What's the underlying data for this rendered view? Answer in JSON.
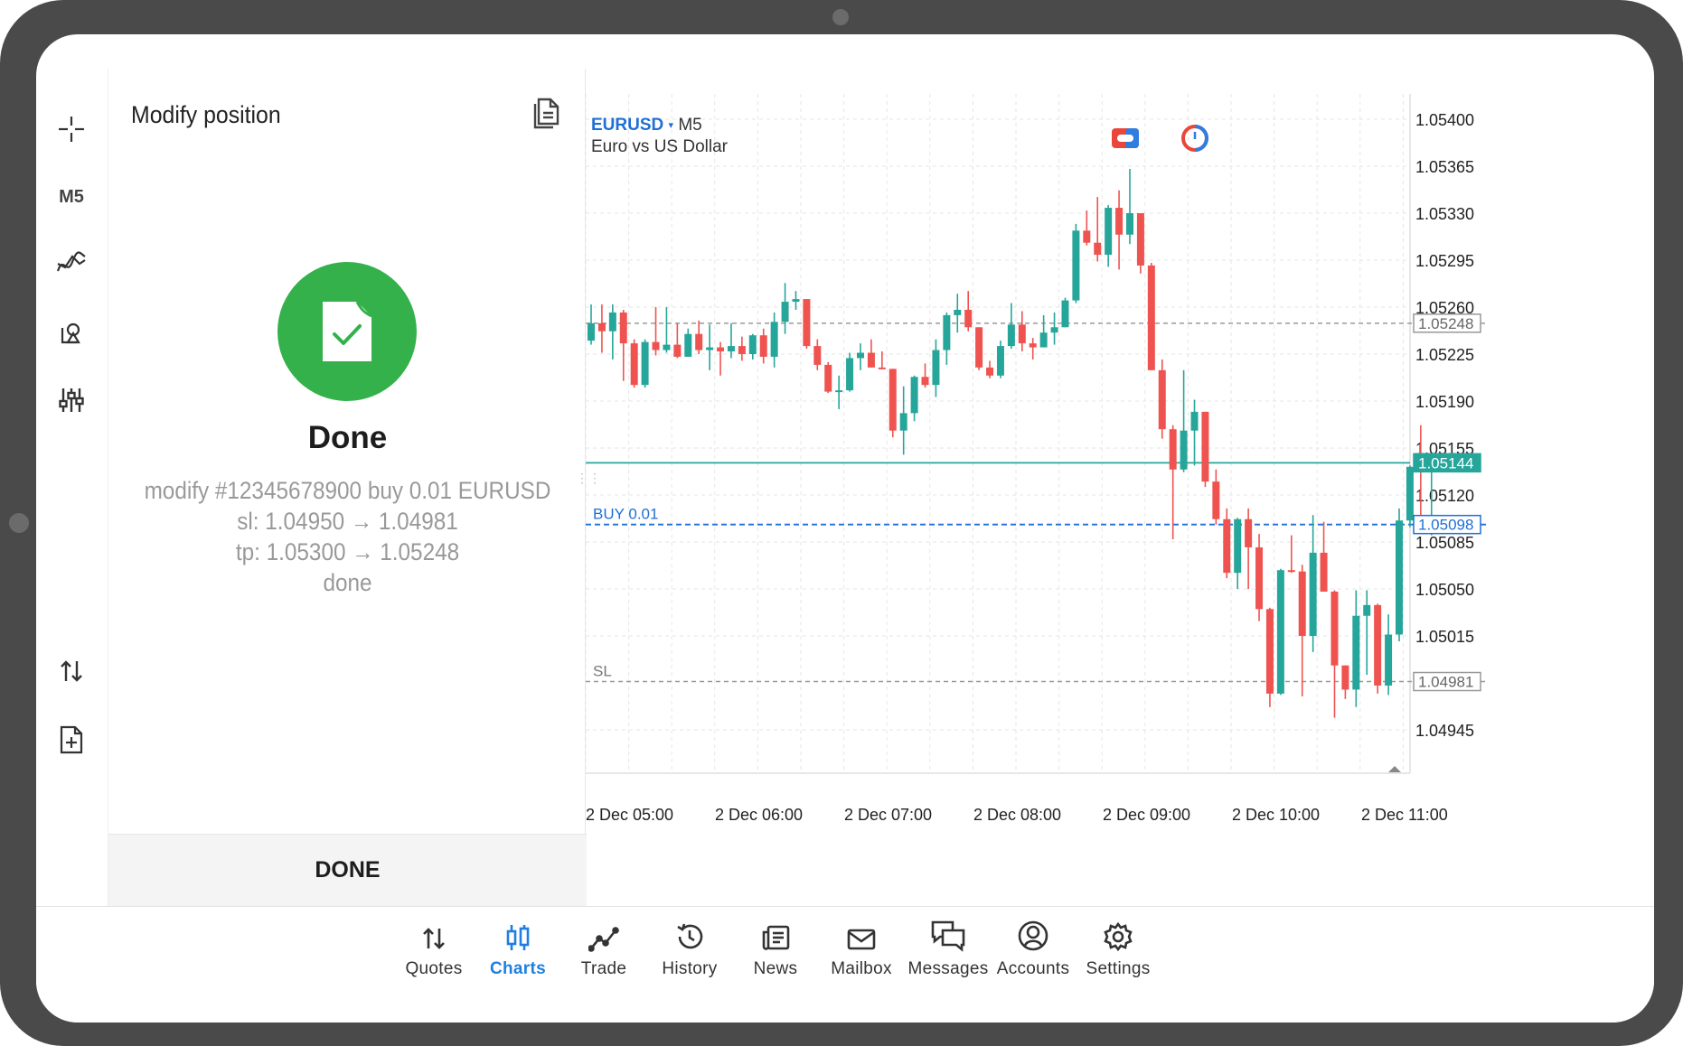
{
  "panel": {
    "title": "Modify position",
    "status": "Done",
    "log": [
      "modify #12345678900 buy 0.01 EURUSD",
      "sl: 1.04950 → 1.04981",
      "tp: 1.05300 → 1.05248",
      "done"
    ],
    "done_button": "DONE"
  },
  "rail": {
    "timeframe": "M5"
  },
  "chart": {
    "symbol": "EURUSD",
    "symbol_arrow": "▾",
    "timeframe": "M5",
    "description": "Euro vs US Dollar",
    "buy_label": "BUY 0.01",
    "sl_label": "SL",
    "colors": {
      "bull": "#26a69a",
      "bear": "#ef5350",
      "bid_line": "#26a69a",
      "buy_line": "#1f6fd6",
      "level_line": "#999999"
    }
  },
  "chart_data": {
    "type": "candlestick",
    "y_ticks": [
      "1.05400",
      "1.05365",
      "1.05330",
      "1.05295",
      "1.05260",
      "1.05225",
      "1.05190",
      "1.05155",
      "1.05120",
      "1.05085",
      "1.05050",
      "1.05015",
      "1.04945"
    ],
    "x_ticks": [
      "2 Dec 05:00",
      "2 Dec 06:00",
      "2 Dec 07:00",
      "2 Dec 08:00",
      "2 Dec 09:00",
      "2 Dec 10:00",
      "2 Dec 11:00"
    ],
    "ylim": [
      1.0492,
      1.0541
    ],
    "levels": {
      "tp": "1.05248",
      "bid": "1.05144",
      "buy": "1.05098",
      "sl": "1.04981"
    },
    "candles": [
      [
        1.05235,
        1.05248,
        1.05262,
        1.05232
      ],
      [
        1.05248,
        1.05242,
        1.05262,
        1.05226
      ],
      [
        1.05242,
        1.05256,
        1.05262,
        1.05221
      ],
      [
        1.05256,
        1.05233,
        1.05258,
        1.05205
      ],
      [
        1.05233,
        1.05202,
        1.05236,
        1.052
      ],
      [
        1.05202,
        1.05234,
        1.05236,
        1.052
      ],
      [
        1.05234,
        1.05228,
        1.0526,
        1.05224
      ],
      [
        1.05228,
        1.05232,
        1.0526,
        1.05226
      ],
      [
        1.05232,
        1.05223,
        1.05248,
        1.05222
      ],
      [
        1.05223,
        1.0524,
        1.05244,
        1.05223
      ],
      [
        1.0524,
        1.05228,
        1.0525,
        1.05225
      ],
      [
        1.05228,
        1.0523,
        1.05247,
        1.05213
      ],
      [
        1.0523,
        1.05227,
        1.05234,
        1.05209
      ],
      [
        1.05227,
        1.05231,
        1.05248,
        1.05222
      ],
      [
        1.05231,
        1.05225,
        1.05238,
        1.0522
      ],
      [
        1.05225,
        1.05239,
        1.0524,
        1.05221
      ],
      [
        1.05239,
        1.05223,
        1.05244,
        1.05218
      ],
      [
        1.05223,
        1.05249,
        1.05256,
        1.05215
      ],
      [
        1.05249,
        1.05264,
        1.05278,
        1.0524
      ],
      [
        1.05264,
        1.05266,
        1.05272,
        1.05258
      ],
      [
        1.05266,
        1.05231,
        1.05266,
        1.05229
      ],
      [
        1.05231,
        1.05217,
        1.05236,
        1.05213
      ],
      [
        1.05217,
        1.05197,
        1.05219,
        1.05196
      ],
      [
        1.05197,
        1.05198,
        1.05209,
        1.05184
      ],
      [
        1.05198,
        1.05222,
        1.05226,
        1.05197
      ],
      [
        1.05222,
        1.05226,
        1.05233,
        1.05213
      ],
      [
        1.05226,
        1.05215,
        1.05236,
        1.05215
      ],
      [
        1.05215,
        1.05214,
        1.05227,
        1.05214
      ],
      [
        1.05214,
        1.05168,
        1.05214,
        1.05163
      ],
      [
        1.05168,
        1.05181,
        1.05201,
        1.0515
      ],
      [
        1.05181,
        1.05208,
        1.05209,
        1.05175
      ],
      [
        1.05208,
        1.05202,
        1.05218,
        1.052
      ],
      [
        1.05202,
        1.05228,
        1.05236,
        1.05193
      ],
      [
        1.05228,
        1.05254,
        1.05256,
        1.05217
      ],
      [
        1.05254,
        1.05258,
        1.0527,
        1.05241
      ],
      [
        1.05258,
        1.05245,
        1.05272,
        1.05242
      ],
      [
        1.05245,
        1.05215,
        1.05245,
        1.05213
      ],
      [
        1.05215,
        1.05209,
        1.0522,
        1.05207
      ],
      [
        1.05209,
        1.05231,
        1.05235,
        1.05207
      ],
      [
        1.05231,
        1.05247,
        1.05263,
        1.05229
      ],
      [
        1.05247,
        1.05233,
        1.05257,
        1.05227
      ],
      [
        1.05233,
        1.0523,
        1.05237,
        1.05221
      ],
      [
        1.0523,
        1.05241,
        1.05254,
        1.05231
      ],
      [
        1.05241,
        1.05245,
        1.05256,
        1.05232
      ],
      [
        1.05245,
        1.05265,
        1.05267,
        1.05245
      ],
      [
        1.05265,
        1.05317,
        1.05322,
        1.05263
      ],
      [
        1.05317,
        1.05308,
        1.05332,
        1.05306
      ],
      [
        1.05308,
        1.05299,
        1.05342,
        1.05294
      ],
      [
        1.05299,
        1.05334,
        1.05336,
        1.0529
      ],
      [
        1.05334,
        1.05314,
        1.05347,
        1.05288
      ],
      [
        1.05314,
        1.0533,
        1.05363,
        1.05307
      ],
      [
        1.0533,
        1.05291,
        1.0533,
        1.05285
      ],
      [
        1.05291,
        1.05213,
        1.05293,
        1.05213
      ],
      [
        1.05213,
        1.05169,
        1.05221,
        1.05162
      ],
      [
        1.05169,
        1.05139,
        1.05172,
        1.05087
      ],
      [
        1.05139,
        1.05168,
        1.05213,
        1.05137
      ],
      [
        1.05168,
        1.05182,
        1.05191,
        1.05142
      ],
      [
        1.05182,
        1.0513,
        1.05182,
        1.05126
      ],
      [
        1.0513,
        1.05102,
        1.05139,
        1.05098
      ],
      [
        1.05102,
        1.05062,
        1.0511,
        1.05058
      ],
      [
        1.05062,
        1.05102,
        1.05103,
        1.0505
      ],
      [
        1.05102,
        1.05081,
        1.0511,
        1.0505
      ],
      [
        1.05081,
        1.05035,
        1.05091,
        1.05026
      ],
      [
        1.05035,
        1.04972,
        1.05036,
        1.04962
      ],
      [
        1.04972,
        1.05064,
        1.05065,
        1.04971
      ],
      [
        1.05064,
        1.05063,
        1.0509,
        1.05062
      ],
      [
        1.05063,
        1.05015,
        1.05068,
        1.0497
      ],
      [
        1.05015,
        1.05077,
        1.05105,
        1.05003
      ],
      [
        1.05077,
        1.05048,
        1.051,
        1.05048
      ],
      [
        1.05048,
        1.04993,
        1.05049,
        1.04954
      ],
      [
        1.04993,
        1.04975,
        1.04993,
        1.04968
      ],
      [
        1.04975,
        1.0503,
        1.05049,
        1.04962
      ],
      [
        1.0503,
        1.05038,
        1.05049,
        1.04986
      ],
      [
        1.05038,
        1.04978,
        1.05039,
        1.04972
      ],
      [
        1.04978,
        1.05016,
        1.05031,
        1.04971
      ],
      [
        1.05016,
        1.05101,
        1.0511,
        1.05011
      ],
      [
        1.05101,
        1.05141,
        1.05142,
        1.05096
      ],
      [
        1.05141,
        1.05137,
        1.05172,
        1.05104
      ],
      [
        1.05137,
        1.05144,
        1.05146,
        1.0509
      ]
    ]
  },
  "nav": [
    {
      "id": "quotes",
      "label": "Quotes",
      "icon": "quotes-arrows-icon"
    },
    {
      "id": "charts",
      "label": "Charts",
      "icon": "candles-icon",
      "active": true
    },
    {
      "id": "trade",
      "label": "Trade",
      "icon": "trade-line-icon"
    },
    {
      "id": "history",
      "label": "History",
      "icon": "history-clock-icon"
    },
    {
      "id": "news",
      "label": "News",
      "icon": "news-icon"
    },
    {
      "id": "mailbox",
      "label": "Mailbox",
      "icon": "envelope-icon"
    },
    {
      "id": "messages",
      "label": "Messages",
      "icon": "chat-bubbles-icon"
    },
    {
      "id": "accounts",
      "label": "Accounts",
      "icon": "account-circle-icon"
    },
    {
      "id": "settings",
      "label": "Settings",
      "icon": "gear-icon"
    }
  ]
}
